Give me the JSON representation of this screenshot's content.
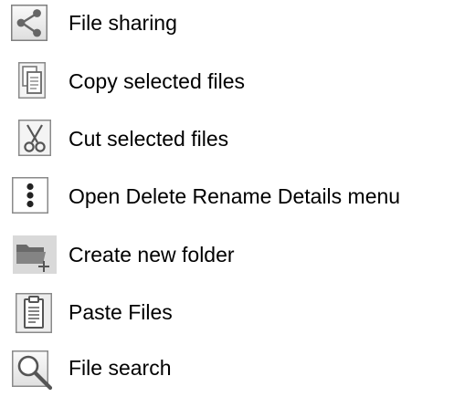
{
  "legend": {
    "items": [
      {
        "icon": "share-icon",
        "label": "File sharing"
      },
      {
        "icon": "copy-icon",
        "label": "Copy selected files"
      },
      {
        "icon": "scissors-icon",
        "label": "Cut selected files"
      },
      {
        "icon": "more-vertical-icon",
        "label": "Open Delete Rename Details menu"
      },
      {
        "icon": "new-folder-icon",
        "label": "Create new folder"
      },
      {
        "icon": "clipboard-icon",
        "label": "Paste Files"
      },
      {
        "icon": "search-icon",
        "label": "File search"
      }
    ]
  },
  "colors": {
    "icon_border": "#7a7a7a",
    "icon_fill_light": "#f2f2f2",
    "icon_glyph": "#6b6b6b",
    "text": "#000000"
  }
}
